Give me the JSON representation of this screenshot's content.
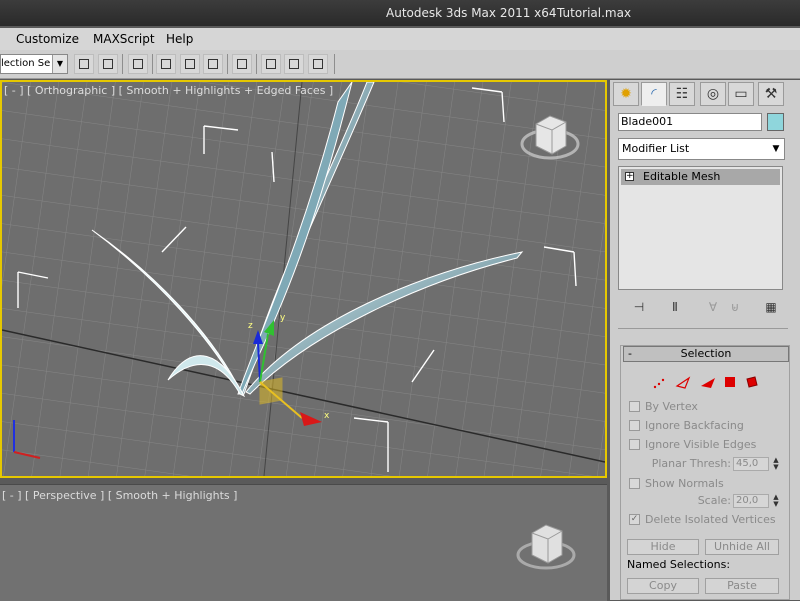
{
  "titlebar": {
    "app": "Autodesk 3ds Max  2011 x64",
    "file": "Tutorial.max"
  },
  "menu": {
    "items": [
      "Customize",
      "MAXScript",
      "Help"
    ]
  },
  "toolbar": {
    "selection_set": "lection Se"
  },
  "viewport_top": {
    "label": "[ - ] [ Orthographic ] [ Smooth + Highlights + Edged Faces ]"
  },
  "viewport_bottom": {
    "label": "[ - ] [ Perspective ] [ Smooth + Highlights ]"
  },
  "gizmo": {
    "x": "x",
    "y": "y",
    "z": "z"
  },
  "panel": {
    "tabs": [
      "create-icon",
      "modify-icon",
      "hierarchy-icon",
      "motion-icon",
      "display-icon",
      "utilities-icon"
    ],
    "object_name": "Blade001",
    "object_color": "#8fd6dc",
    "modifier_list": "Modifier List",
    "stack_item": "Editable Mesh",
    "selection": {
      "title": "Selection",
      "by_vertex": "By Vertex",
      "ignore_backfacing": "Ignore Backfacing",
      "ignore_visible_edges": "Ignore Visible Edges",
      "planar_thresh_label": "Planar Thresh:",
      "planar_thresh_value": "45,0",
      "show_normals": "Show Normals",
      "scale_label": "Scale:",
      "scale_value": "20,0",
      "delete_isolated": "Delete Isolated Vertices",
      "hide": "Hide",
      "unhide_all": "Unhide All",
      "named_selections": "Named Selections:",
      "copy": "Copy",
      "paste": "Paste"
    }
  }
}
